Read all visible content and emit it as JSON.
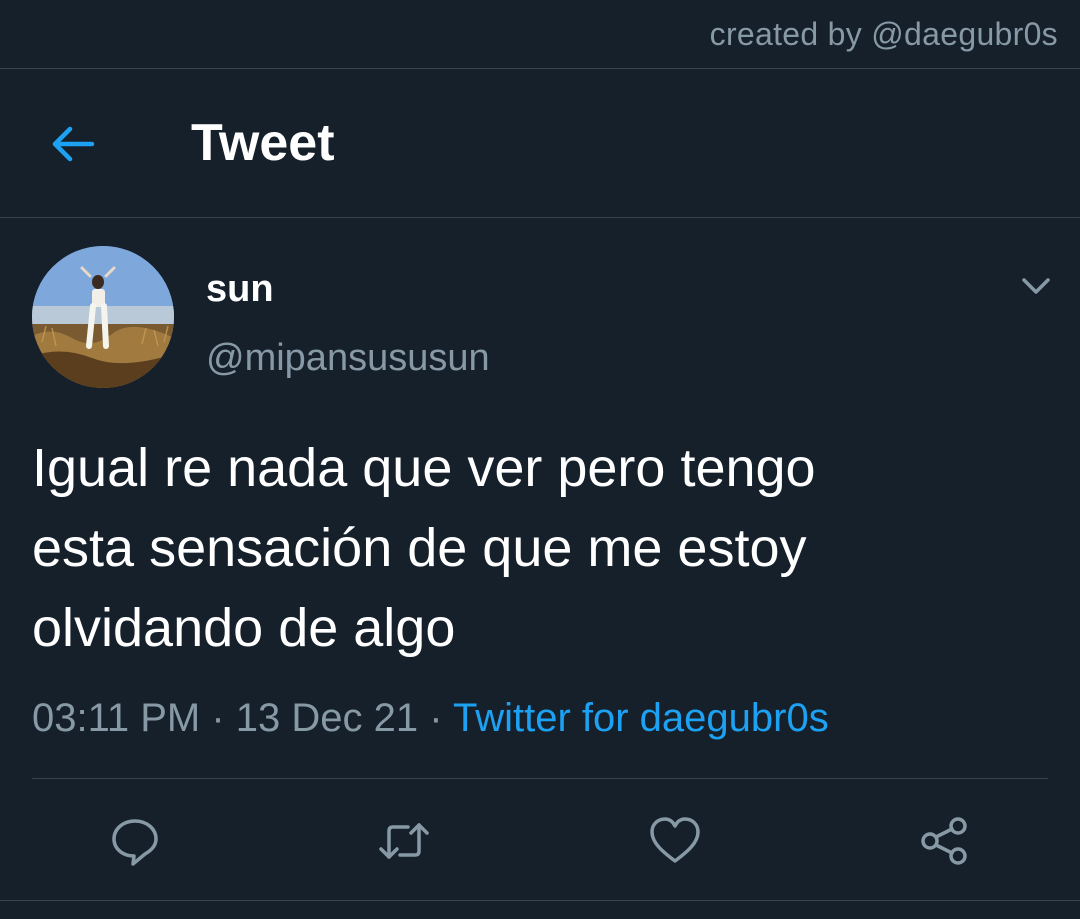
{
  "credit": {
    "text": "created by @daegubr0s"
  },
  "header": {
    "back_icon": "arrow-left-icon",
    "title": "Tweet"
  },
  "tweet": {
    "author": {
      "display_name": "sun",
      "handle": "@mipansususun",
      "avatar": "profile-photo"
    },
    "more_icon": "chevron-down-icon",
    "text": "Igual re nada que ver pero tengo\nesta sensación de que me estoy\nolvidando de algo",
    "time": "03:11 PM",
    "separator": " · ",
    "date": "13 Dec 21",
    "source": "Twitter for daegubr0s"
  },
  "actions": {
    "reply_icon": "reply-icon",
    "retweet_icon": "retweet-icon",
    "like_icon": "heart-icon",
    "share_icon": "share-icon"
  },
  "colors": {
    "background": "#15202b",
    "accent": "#1da1f2",
    "secondary_text": "#8899a6",
    "border": "#38444d"
  }
}
